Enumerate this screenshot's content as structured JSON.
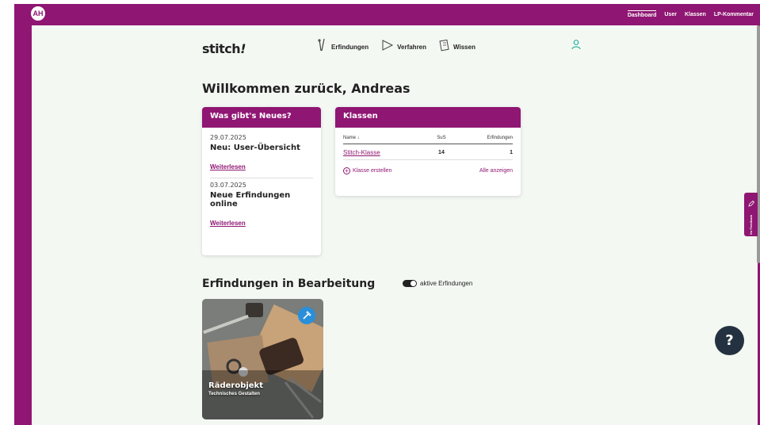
{
  "admin_nav": {
    "avatar_initials": "AH",
    "items": [
      "Dashboard",
      "User",
      "Klassen",
      "LP-Kommentar"
    ]
  },
  "brand": {
    "logo_text": "stitch",
    "logo_bang": "!"
  },
  "main_nav": {
    "items": [
      {
        "label": "Erfindungen",
        "icon": "needle-icon"
      },
      {
        "label": "Verfahren",
        "icon": "fabric-icon"
      },
      {
        "label": "Wissen",
        "icon": "book-icon"
      }
    ],
    "user_icon": "user-icon"
  },
  "welcome": {
    "text": "Willkommen zurück, Andreas"
  },
  "news": {
    "title": "Was gibt's Neues?",
    "items": [
      {
        "date": "29.07.2025",
        "title": "Neu: User-Übersicht",
        "link": "Weiterlesen"
      },
      {
        "date": "03.07.2025",
        "title": "Neue Erfindungen online",
        "link": "Weiterlesen"
      }
    ]
  },
  "classes": {
    "title": "Klassen",
    "columns": [
      "Name ↓",
      "SuS",
      "Erfindungen"
    ],
    "rows": [
      {
        "name": "Stitch-Klasse",
        "sus": "14",
        "inventions": "1"
      }
    ],
    "create_label": "Klasse erstellen",
    "show_all_label": "Alle anzeigen"
  },
  "in_progress": {
    "title": "Erfindungen in Bearbeitung",
    "toggle_label": "aktive Erfindungen",
    "toggle_on": true,
    "projects": [
      {
        "title": "Räderobjekt",
        "subtitle": "Technisches Gestalten",
        "badge_icon": "hammer-icon"
      }
    ]
  },
  "feedback": {
    "label": "Ihr Feedback",
    "icon": "pencil-icon"
  },
  "help": {
    "icon": "question-icon",
    "glyph": "?"
  },
  "colors": {
    "brand": "#8f1672",
    "background": "#f4f8f3",
    "help_button": "#243140",
    "badge": "#2a8fd9"
  }
}
